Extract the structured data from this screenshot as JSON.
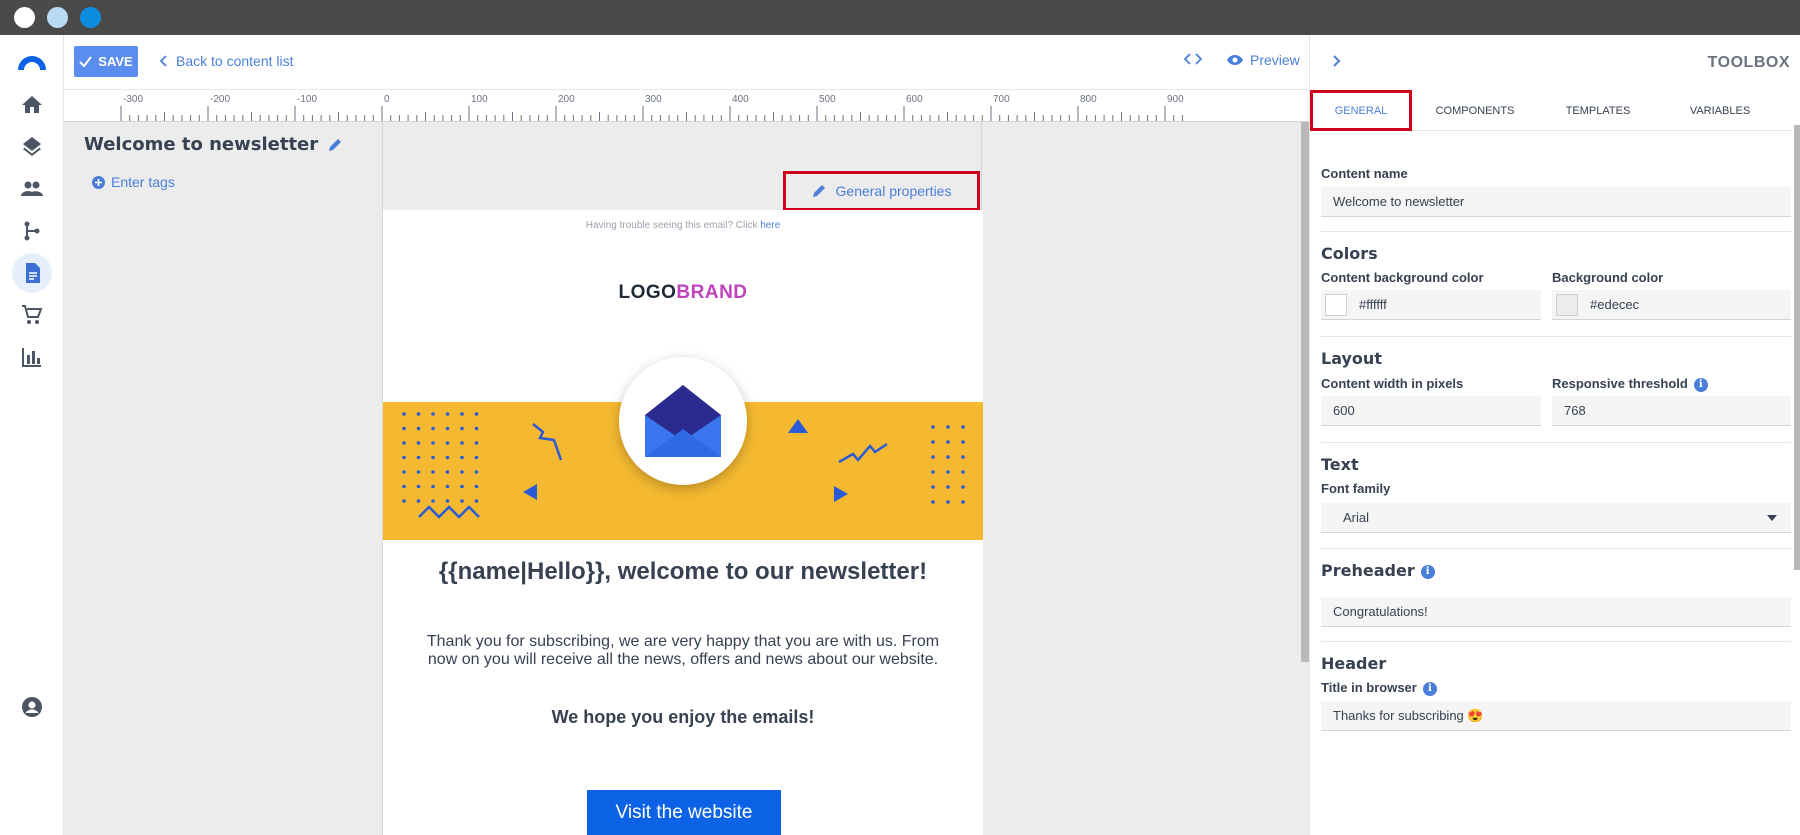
{
  "window": {
    "dots": [
      "#ffffff",
      "#b8dcf4",
      "#0b8ee0"
    ]
  },
  "nav": {
    "items": [
      {
        "icon": "home-icon"
      },
      {
        "icon": "layers-icon"
      },
      {
        "icon": "people-icon"
      },
      {
        "icon": "flow-icon"
      },
      {
        "icon": "document-icon",
        "active": true
      },
      {
        "icon": "cart-icon"
      },
      {
        "icon": "chart-icon"
      },
      {
        "icon": "account-icon"
      }
    ]
  },
  "toolbar": {
    "save_label": "SAVE",
    "back_label": "Back to content list",
    "preview_label": "Preview"
  },
  "ruler": {
    "ticks": [
      "-300",
      "-200",
      "-100",
      "0",
      "100",
      "200",
      "300",
      "400",
      "500",
      "600",
      "700",
      "800",
      "900"
    ]
  },
  "canvas": {
    "content_title": "Welcome to newsletter",
    "enter_tags": "Enter tags",
    "general_properties": "General properties"
  },
  "email": {
    "trouble_text": "Having trouble seeing this email? Click ",
    "trouble_link": "here",
    "logo_part1": "LOGO",
    "logo_part2": "BRAND",
    "headline": "{{name|Hello}}, welcome to our newsletter!",
    "body": "Thank you for subscribing, we are very happy that you are with us. From now on you will receive all the news, offers and news about our website.",
    "hope": "We hope you enjoy the emails!",
    "button": "Visit the website"
  },
  "toolbox": {
    "title": "TOOLBOX",
    "tabs": [
      "GENERAL",
      "COMPONENTS",
      "TEMPLATES",
      "VARIABLES"
    ],
    "content_name_label": "Content name",
    "content_name_value": "Welcome to newsletter",
    "colors_title": "Colors",
    "content_bg_label": "Content background color",
    "content_bg_value": "#ffffff",
    "bg_label": "Background color",
    "bg_value": "#edecec",
    "layout_title": "Layout",
    "width_label": "Content width in pixels",
    "width_value": "600",
    "threshold_label": "Responsive threshold",
    "threshold_value": "768",
    "text_title": "Text",
    "font_family_label": "Font family",
    "font_family_value": "Arial",
    "preheader_title": "Preheader",
    "preheader_value": "Congratulations!",
    "header_title": "Header",
    "browser_title_label": "Title in browser",
    "browser_title_value": "Thanks for subscribing 😍"
  }
}
